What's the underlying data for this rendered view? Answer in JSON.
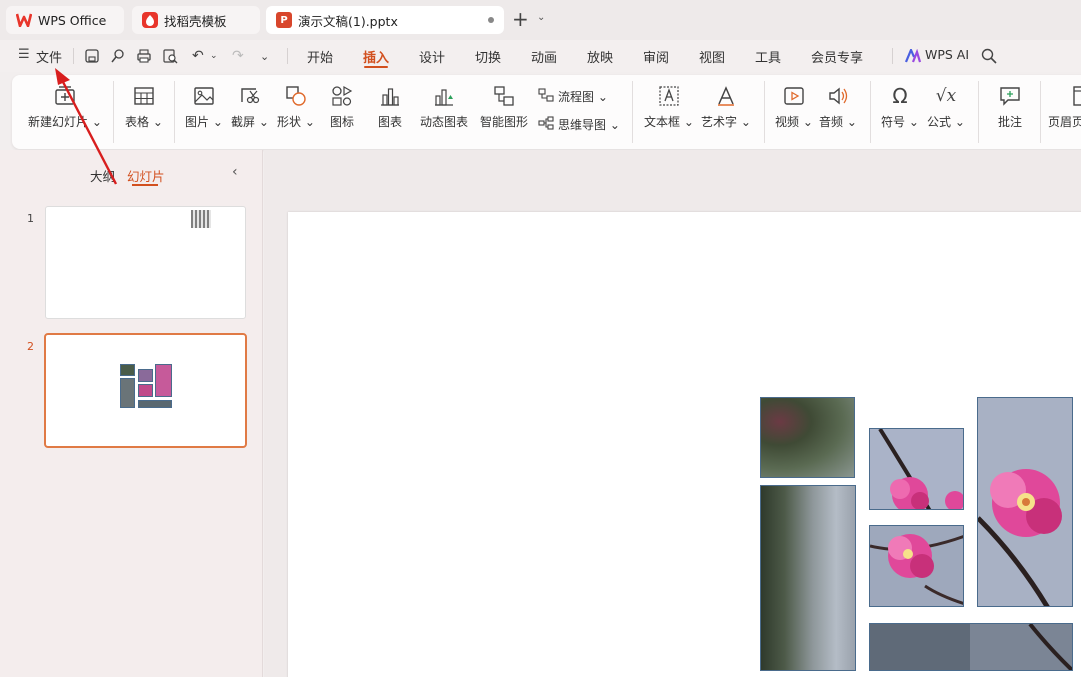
{
  "tabs": [
    {
      "label": "WPS Office"
    },
    {
      "label": "找稻壳模板"
    },
    {
      "label": "演示文稿(1).pptx"
    }
  ],
  "menu": {
    "file_label": "文件",
    "items": [
      "开始",
      "插入",
      "设计",
      "切换",
      "动画",
      "放映",
      "审阅",
      "视图",
      "工具",
      "会员专享"
    ],
    "selected": "插入",
    "ai_label": "WPS AI"
  },
  "ribbon": {
    "new_slide": "新建幻灯片",
    "table": "表格",
    "picture": "图片",
    "screenshot": "截屏",
    "shape": "形状",
    "icon": "图标",
    "chart": "图表",
    "dynamic_chart": "动态图表",
    "smart_graphic": "智能图形",
    "flowchart": "流程图",
    "mindmap": "思维导图",
    "textbox": "文本框",
    "wordart": "艺术字",
    "video": "视频",
    "audio": "音频",
    "symbol": "符号",
    "formula": "公式",
    "comment": "批注",
    "header_footer": "页眉页"
  },
  "left_panel": {
    "tab_outline": "大纲",
    "tab_slides": "幻灯片",
    "slides": [
      {
        "number": "1"
      },
      {
        "number": "2"
      }
    ]
  },
  "colors": {
    "accent": "#d2501f",
    "wps_red": "#e8352b",
    "tile_border": "#4a6b8c",
    "arrow": "#d81e1e"
  }
}
